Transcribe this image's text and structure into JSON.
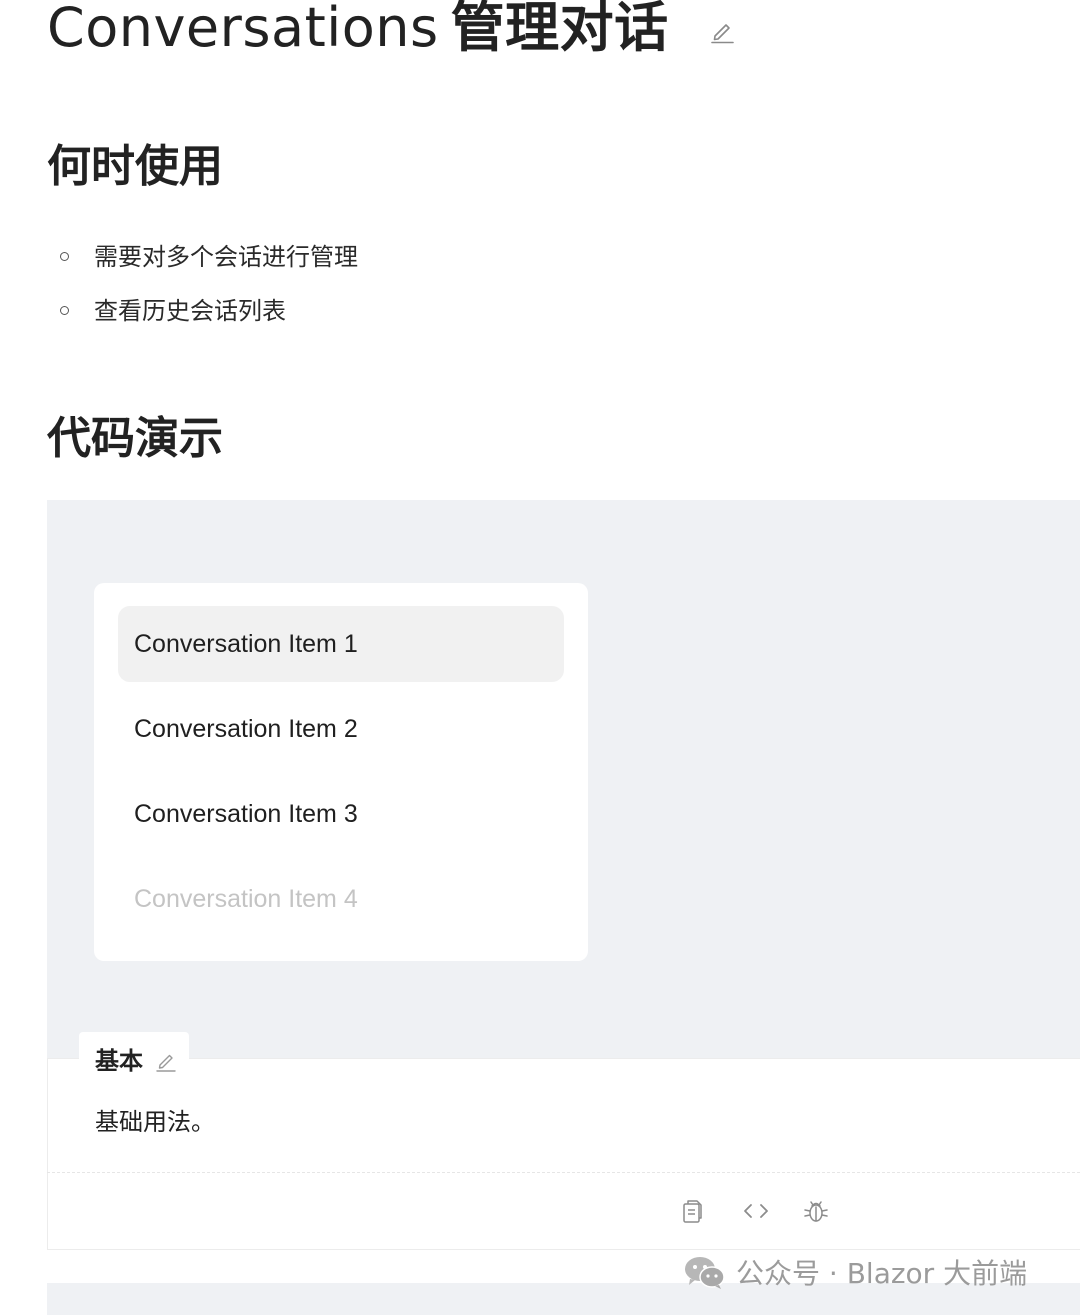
{
  "page": {
    "title_en": "Conversations",
    "title_zh": "管理对话"
  },
  "sections": {
    "when_to_use": {
      "heading": "何时使用",
      "items": [
        "需要对多个会话进行管理",
        "查看历史会话列表"
      ]
    },
    "demo": {
      "heading": "代码演示"
    }
  },
  "conversations": {
    "items": [
      {
        "label": "Conversation Item 1",
        "state": "active"
      },
      {
        "label": "Conversation Item 2",
        "state": "normal"
      },
      {
        "label": "Conversation Item 3",
        "state": "normal"
      },
      {
        "label": "Conversation Item 4",
        "state": "disabled"
      }
    ]
  },
  "demo_meta": {
    "title": "基本",
    "description": "基础用法。"
  },
  "actions": {
    "icons": [
      "copy-icon",
      "code-icon",
      "bug-icon"
    ]
  },
  "watermark": {
    "text": "公众号 · Blazor 大前端",
    "icon": "wechat-icon"
  },
  "colors": {
    "demo_background": "#eff1f4",
    "active_item_background": "#f1f1f1",
    "disabled_text": "#c4c4c4"
  }
}
